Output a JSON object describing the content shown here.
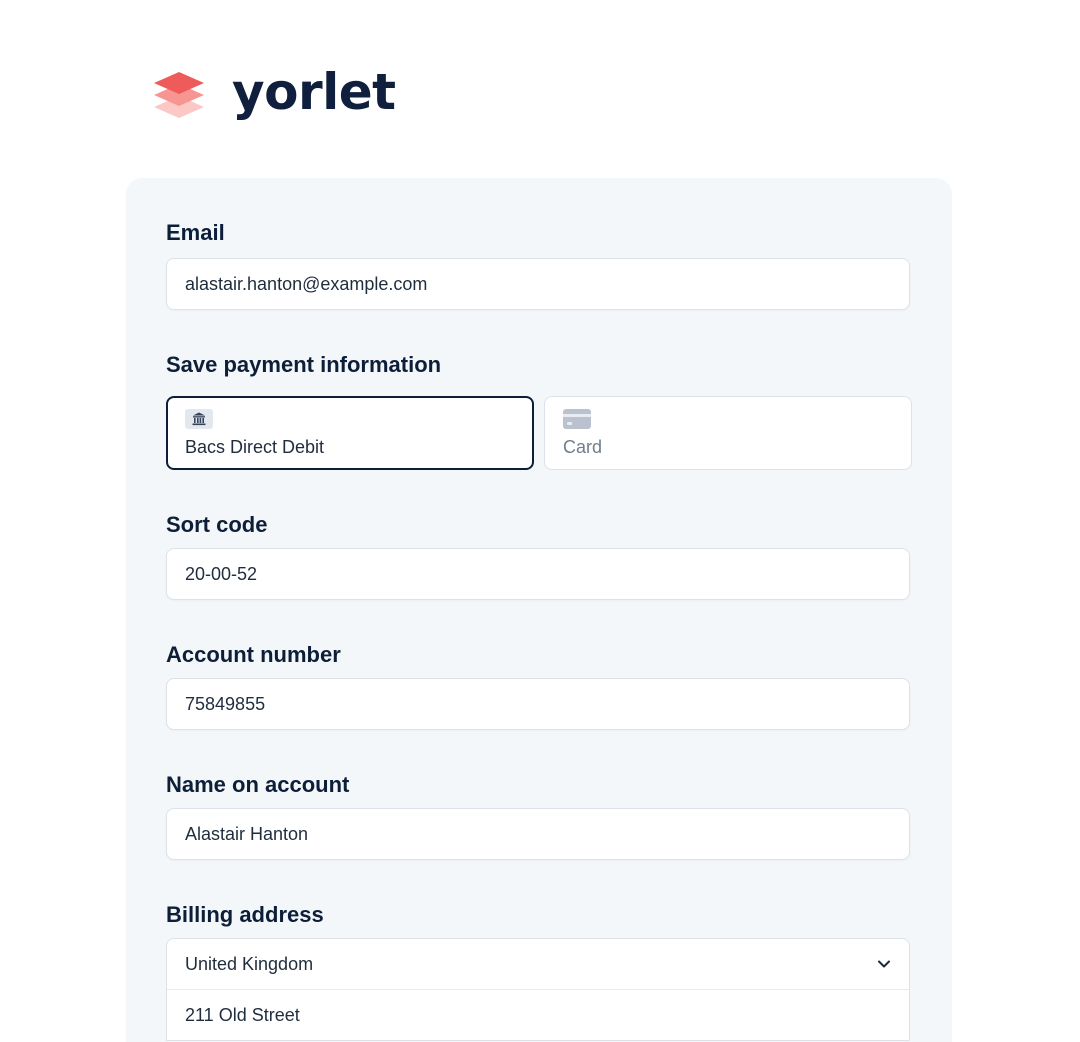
{
  "brand": {
    "name": "yorlet",
    "logo_icon": "stacked-layers-icon",
    "accent": "#ef5a5a"
  },
  "form": {
    "email": {
      "label": "Email",
      "value": "alastair.hanton@example.com"
    },
    "payment": {
      "label": "Save payment information",
      "methods": [
        {
          "label": "Bacs Direct Debit",
          "icon": "bank-icon",
          "selected": true
        },
        {
          "label": "Card",
          "icon": "credit-card-icon",
          "selected": false
        }
      ]
    },
    "sort_code": {
      "label": "Sort code",
      "value": "20-00-52"
    },
    "account_number": {
      "label": "Account number",
      "value": "75849855"
    },
    "name_on_account": {
      "label": "Name on account",
      "value": "Alastair Hanton"
    },
    "billing_address": {
      "label": "Billing address",
      "country": "United Kingdom",
      "line1": "211 Old Street"
    }
  }
}
